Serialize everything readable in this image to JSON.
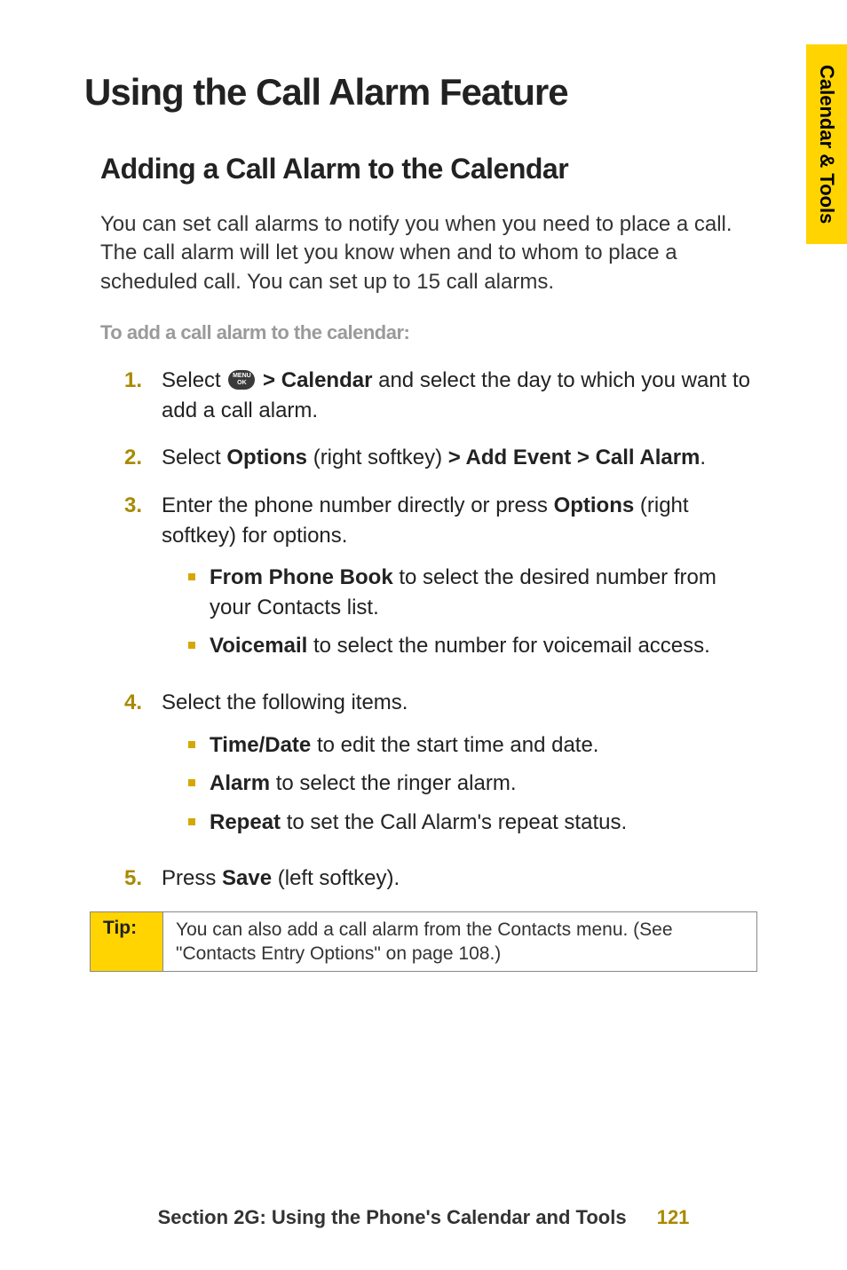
{
  "sideTab": "Calendar & Tools",
  "title": "Using the Call Alarm Feature",
  "sectionHeading": "Adding a Call Alarm to the Calendar",
  "intro": "You can set call alarms to notify you when you need to place a call. The call alarm will let you know when and to whom to place a scheduled call. You can set up to 15 call alarms.",
  "subhead": "To add a call alarm to the calendar:",
  "menuIcon": {
    "line1": "MENU",
    "line2": "OK"
  },
  "steps": [
    {
      "num": "1.",
      "prefix": "Select ",
      "hasIcon": true,
      "afterIcon_pre_bold": " > ",
      "afterIcon_bold": "Calendar",
      "afterIcon_tail": " and select the day to which you want to add a call alarm."
    },
    {
      "num": "2.",
      "parts": [
        {
          "t": "Select "
        },
        {
          "t": "Options",
          "b": true
        },
        {
          "t": " (right softkey) "
        },
        {
          "t": "> Add Event > Call Alarm",
          "b": true
        },
        {
          "t": "."
        }
      ]
    },
    {
      "num": "3.",
      "parts": [
        {
          "t": "Enter the phone number directly or press "
        },
        {
          "t": "Options",
          "b": true
        },
        {
          "t": " (right softkey) for options."
        }
      ],
      "sub": [
        {
          "bold": "From Phone Book",
          "tail": " to select the desired number from your Contacts list."
        },
        {
          "bold": "Voicemail",
          "tail": " to select the number for voicemail access."
        }
      ]
    },
    {
      "num": "4.",
      "parts": [
        {
          "t": "Select the following items."
        }
      ],
      "sub": [
        {
          "bold": "Time/Date",
          "tail": " to edit the start time and date."
        },
        {
          "bold": "Alarm",
          "tail": " to select the ringer alarm."
        },
        {
          "bold": "Repeat",
          "tail": " to set the Call Alarm's repeat status."
        }
      ]
    },
    {
      "num": "5.",
      "parts": [
        {
          "t": "Press "
        },
        {
          "t": "Save",
          "b": true
        },
        {
          "t": " (left softkey)."
        }
      ]
    }
  ],
  "tip": {
    "label": "Tip:",
    "text": "You can also add a call alarm from the Contacts menu. (See \"Contacts Entry Options\" on page 108.)"
  },
  "footer": {
    "text": "Section 2G: Using the Phone's Calendar and Tools",
    "page": "121"
  }
}
